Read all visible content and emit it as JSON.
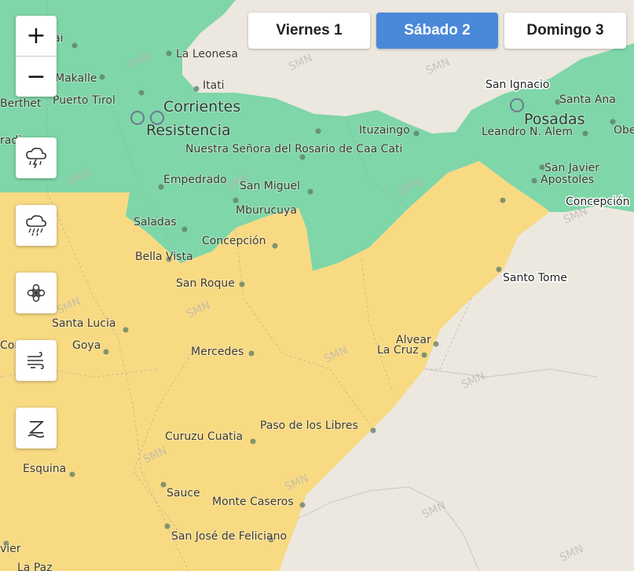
{
  "days": [
    {
      "label": "Viernes 1",
      "active": false
    },
    {
      "label": "Sábado 2",
      "active": true
    },
    {
      "label": "Domingo 3",
      "active": false
    }
  ],
  "zoom": {
    "in_label": "+",
    "out_label": "−"
  },
  "layer_buttons": [
    "thunderstorm-icon",
    "rain-icon",
    "snow-icon",
    "wind-icon",
    "zonda-icon"
  ],
  "watermark": "SMN",
  "colors": {
    "alert_yellow": "#f8da83",
    "no_alert_green": "#7fd6a8",
    "land": "#ece8df",
    "active_tab": "#4a88d8"
  },
  "places": {
    "ai": "ai",
    "la_leonesa": "La Leonesa",
    "makalle": "Makalle",
    "itati": "Itati",
    "san_ignacio": "San Ignacio",
    "berthet": "Berthet",
    "puerto_tirol": "Puerto Tirol",
    "corrientes": "Corrientes",
    "santa_ana": "Santa Ana",
    "posadas": "Posadas",
    "resistencia": "Resistencia",
    "ituzaingo": "Ituzaingo",
    "leandro": "Leandro N. Alem",
    "obe": "Obe",
    "radi": "radi",
    "caa_cati": "Nuestra Señora del Rosario de Caa Cati",
    "san_javier": "San Javier",
    "apostoles": "Apostoles",
    "empedrado": "Empedrado",
    "san_miguel": "San Miguel",
    "concepcion_ne": "Concepción",
    "mburucuya": "Mburucuya",
    "saladas": "Saladas",
    "concepcion": "Concepción",
    "bella_vista": "Bella Vista",
    "santo_tome": "Santo Tome",
    "san_roque": "San Roque",
    "santa_lucia": "Santa Lucia",
    "goya": "Goya",
    "cor": "Cor",
    "alvear": "Alvear",
    "la_cruz": "La Cruz",
    "mercedes": "Mercedes",
    "paso_libres": "Paso de los Libres",
    "curuzu_cuatia": "Curuzu Cuatia",
    "esquina": "Esquina",
    "sauce": "Sauce",
    "monte_caseros": "Monte Caseros",
    "san_jose_feliciano": "San José de Feliciano",
    "vier": "vier",
    "la_paz": "La Paz"
  }
}
